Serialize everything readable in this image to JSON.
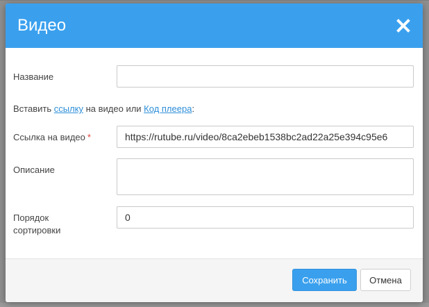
{
  "dialog": {
    "title": "Видео",
    "close_icon": "close-icon"
  },
  "form": {
    "name_label": "Название",
    "name_value": "",
    "embed_prefix": "Вставить ",
    "embed_link_label": "ссылку",
    "embed_middle": " на видео или ",
    "embed_code_label": "Код плеера",
    "embed_suffix": ":",
    "video_url_label": "Ссылка на видео",
    "video_url_required_mark": "*",
    "video_url_value": "https://rutube.ru/video/8ca2ebeb1538bc2ad22a25e394c95e6",
    "description_label": "Описание",
    "description_value": "",
    "sort_order_label_line1": "Порядок",
    "sort_order_label_line2": "сортировки",
    "sort_order_value": "0"
  },
  "footer": {
    "save_label": "Сохранить",
    "cancel_label": "Отмена"
  },
  "colors": {
    "accent": "#3aa0ee",
    "link": "#2d8ed8",
    "required": "#e0413b"
  }
}
